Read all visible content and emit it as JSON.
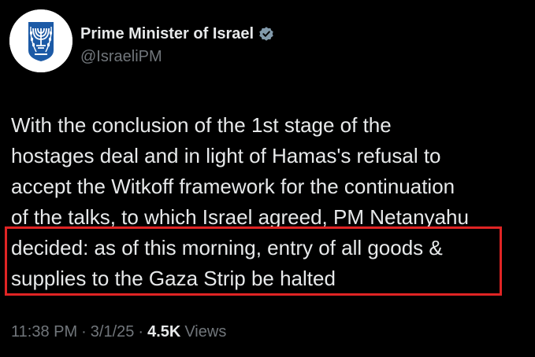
{
  "account": {
    "display_name": "Prime Minister of Israel",
    "handle": "@IsraeliPM",
    "verified_icon": "verified-badge-icon",
    "avatar_icon": "menorah-emblem-icon"
  },
  "tweet": {
    "lines": [
      "With the conclusion of the 1st stage of the",
      "hostages deal and in light of Hamas's refusal to",
      "accept the Witkoff framework for the continuation",
      "of the talks, to which Israel agreed, PM Netanyahu",
      "decided: as of this morning, entry of all goods &",
      "supplies to the Gaza Strip be halted"
    ]
  },
  "meta": {
    "time": "11:38 PM",
    "separator": "·",
    "date": "3/1/25",
    "views_count": "4.5K",
    "views_label": "Views"
  },
  "colors": {
    "background": "#000000",
    "primary_text": "#e7e9ea",
    "secondary_text": "#71767b",
    "verified_badge": "#829aab",
    "highlight_border": "#e02424",
    "emblem_blue": "#1c5aa6"
  }
}
